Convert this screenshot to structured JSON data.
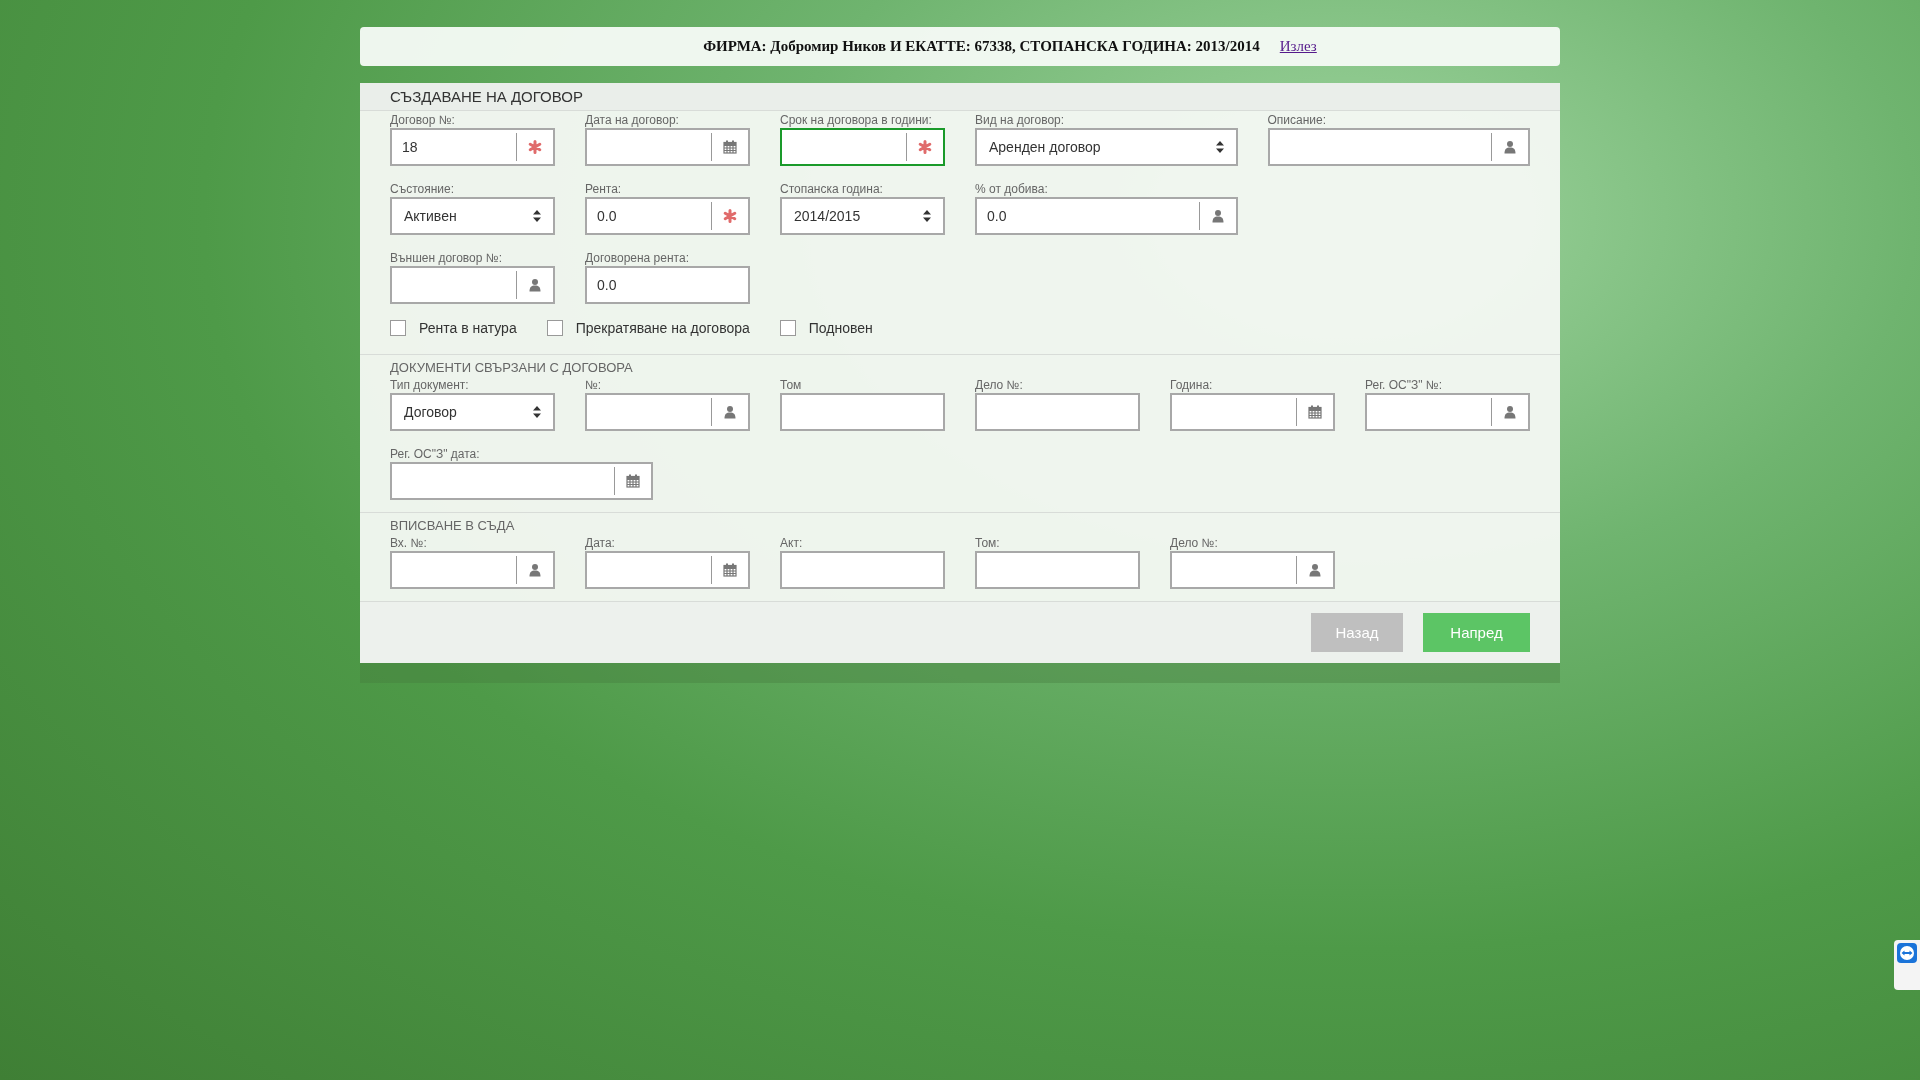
{
  "header": {
    "title": "ФИРМА: Добромир Ников И ЕКАТТЕ: 67338, СТОПАНСКА ГОДИНА: 2013/2014",
    "logout": "Излез"
  },
  "form": {
    "title": "СЪЗДАВАНЕ НА ДОГОВОР",
    "sections": [
      {
        "rows": [
          [
            {
              "label": "Договор №:",
              "kind": "required",
              "value": "18",
              "focused": false
            },
            {
              "label": "Дата на договор:",
              "kind": "date",
              "focused": false
            },
            {
              "label": "Срок на договора в години:",
              "kind": "required",
              "focused": true
            },
            {
              "label": "Вид на договор:",
              "kind": "select",
              "value": "Аренден договор",
              "focused": false
            },
            {
              "label": "Описание:",
              "kind": "lookup",
              "focused": false
            }
          ],
          [
            {
              "label": "Състояние:",
              "kind": "select",
              "value": "Активен",
              "focused": false
            },
            {
              "label": "Рента:",
              "kind": "required",
              "value": "0.0",
              "focused": false
            },
            {
              "label": "Стопанска година:",
              "kind": "select",
              "value": "2014/2015",
              "focused": false
            },
            {
              "label": "% от добива:",
              "kind": "lookup",
              "value": "0.0",
              "focused": false
            }
          ],
          [
            {
              "label": "Външен договор №:",
              "kind": "lookup",
              "focused": false
            },
            {
              "label": "Договорена рента:",
              "kind": "plain",
              "value": "0.0",
              "focused": false
            }
          ]
        ],
        "checkboxes": [
          {
            "label": "Рента в натура",
            "checked": false
          },
          {
            "label": "Прекратяване на договора",
            "checked": false
          },
          {
            "label": "Подновен",
            "checked": false
          }
        ]
      },
      {
        "heading": "ДОКУМЕНТИ СВЪРЗАНИ С ДОГОВОРА",
        "rows": [
          [
            {
              "label": "Тип документ:",
              "kind": "select",
              "value": "Договор",
              "focused": false
            },
            {
              "label": "№:",
              "kind": "lookup",
              "focused": false
            },
            {
              "label": "Том",
              "kind": "plain",
              "focused": false
            },
            {
              "label": "Дело №:",
              "kind": "plain",
              "focused": false
            },
            {
              "label": "Година:",
              "kind": "date",
              "focused": false
            },
            {
              "label": "Рег. ОС\"З\" №:",
              "kind": "lookup",
              "focused": false
            }
          ],
          [
            {
              "label": "Рег. ОС\"З\" дата:",
              "kind": "date",
              "focused": false
            }
          ]
        ]
      },
      {
        "heading": "ВПИСВАНЕ В СЪДА",
        "rows": [
          [
            {
              "label": "Вх. №:",
              "kind": "lookup",
              "focused": false
            },
            {
              "label": "Дата:",
              "kind": "date",
              "focused": false
            },
            {
              "label": "Акт:",
              "kind": "plain",
              "focused": false
            },
            {
              "label": "Том:",
              "kind": "plain",
              "focused": false
            },
            {
              "label": "Дело №:",
              "kind": "lookup",
              "focused": false
            }
          ]
        ]
      }
    ],
    "buttons": [
      {
        "label": "Назад",
        "kind": "secondary"
      },
      {
        "label": "Напред",
        "kind": "primary"
      }
    ]
  }
}
